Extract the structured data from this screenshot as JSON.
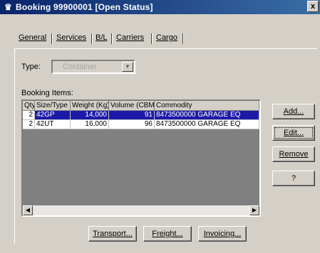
{
  "window": {
    "title": "Booking 99900001 [Open Status]",
    "close_glyph": "x"
  },
  "tabs": [
    {
      "label": "General",
      "active": false
    },
    {
      "label": "Services",
      "active": false
    },
    {
      "label": "B/L",
      "active": false
    },
    {
      "label": "Carriers",
      "active": false
    },
    {
      "label": "Cargo",
      "active": true
    }
  ],
  "type_field": {
    "label": "Type:",
    "value": "Container",
    "disabled": true
  },
  "booking_items": {
    "label": "Booking Items:",
    "columns": [
      "Qty",
      "Size/Type",
      "Weight (Kg)",
      "Volume (CBM)",
      "Commodity"
    ],
    "rows": [
      {
        "qty": "2",
        "size_type": "42GP",
        "weight": "14,000",
        "volume": "91",
        "commodity": "8473500000 GARAGE EQ",
        "selected": true
      },
      {
        "qty": "2",
        "size_type": "42UT",
        "weight": "16,000",
        "volume": "96",
        "commodity": "8473500000 GARAGE EQ",
        "selected": false
      }
    ]
  },
  "side_buttons": {
    "add": "Add...",
    "edit": "Edit...",
    "remove": "Remove",
    "help": "?"
  },
  "bottom_buttons": {
    "transport": "Transport...",
    "freight": "Freight...",
    "invoicing": "Invoicing..."
  },
  "colors": {
    "titlebar_start": "#0a246a",
    "titlebar_end": "#3a6ea5",
    "selection": "#1d1aa8",
    "face": "#d4d0c8"
  }
}
